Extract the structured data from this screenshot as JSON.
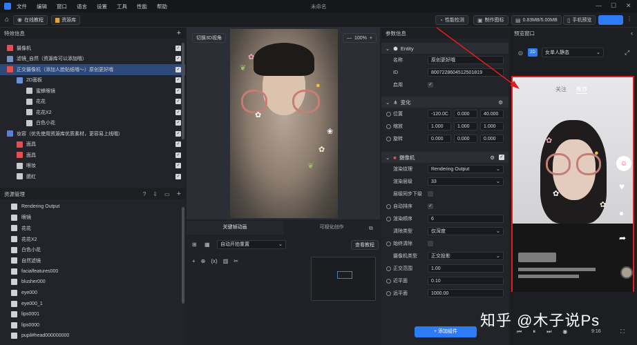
{
  "menubar": {
    "items": [
      "文件",
      "编辑",
      "窗口",
      "语言",
      "设置",
      "工具",
      "性能",
      "帮助"
    ],
    "title": "未命名"
  },
  "toolbar": {
    "online_tutorial": "在线教程",
    "asset_library": "资源库",
    "perf_check": "性能检测",
    "make_icon": "制作图标",
    "memory": "0.83MB/5.00MB",
    "phone_preview": "手机预览"
  },
  "effects_panel": {
    "title": "特效信息",
    "items": [
      {
        "label": "摄像机",
        "indent": 0
      },
      {
        "label": "滤镜_自然（资源库可以添加哦）",
        "indent": 0
      },
      {
        "label": "正交摄像机（添加人脸贴纸哦～）原创更好哦",
        "indent": 0,
        "selected": true
      },
      {
        "label": "2D面板",
        "indent": 1
      },
      {
        "label": "蜜蜂眼镜",
        "indent": 2
      },
      {
        "label": "花花",
        "indent": 2
      },
      {
        "label": "花花X2",
        "indent": 2
      },
      {
        "label": "白色小花",
        "indent": 2
      },
      {
        "label": "妆容（优先使用资源库优质素材，更容易上线哦）",
        "indent": 0
      },
      {
        "label": "面具",
        "indent": 1
      },
      {
        "label": "面具",
        "indent": 1
      },
      {
        "label": "眼妆",
        "indent": 1
      },
      {
        "label": "腮红",
        "indent": 1
      }
    ]
  },
  "resource_panel": {
    "title": "资源管理",
    "items": [
      "Rendering Output",
      "眼镜",
      "花花",
      "花花X2",
      "白色小花",
      "自然滤镜",
      "facialfeatures000",
      "blusher000",
      "eye000",
      "eye000_1",
      "lips0001",
      "lips0000",
      "pupil#head000000000"
    ]
  },
  "viewport": {
    "toggle_3d": "切换3D视角",
    "zoom": "100%"
  },
  "timeline": {
    "tab_keyframe": "关键帧动画",
    "tab_visual": "可视化创作",
    "play_mode": "自动开拍重置",
    "view_tutorial": "查看教程"
  },
  "params": {
    "title": "参数信息",
    "entity": {
      "title": "Entity",
      "name_label": "名称",
      "name_value": "原创更好哦",
      "id_label": "ID",
      "id_value": "8007228604512501819",
      "enable_label": "启用"
    },
    "transform": {
      "title": "变化",
      "pos_label": "位置",
      "pos": [
        "-120.0C",
        "0.000",
        "40.000"
      ],
      "scale_label": "缩放",
      "scale": [
        "1.000",
        "1.000",
        "1.000"
      ],
      "rot_label": "旋转",
      "rot": [
        "0.000",
        "0.000",
        "0.000"
      ]
    },
    "camera": {
      "title": "摄像机",
      "rt_label": "渲染纹理",
      "rt_value": "Rendering Output",
      "layer_label": "渲染层级",
      "layer_value": "33",
      "sync_label": "层级同步下级",
      "autosort_label": "自动排序",
      "order_label": "渲染顺序",
      "order_value": "6",
      "clear_label": "清除类型",
      "clear_value": "仅深度",
      "alwaysclear_label": "始终清除",
      "camtype_label": "摄像机类型",
      "camtype_value": "正交投影",
      "ortho_label": "正交范围",
      "ortho_value": "1.00",
      "near_label": "近平面",
      "near_value": "0.10",
      "far_label": "远平面",
      "far_value": "1000.00"
    },
    "add_component": "添加组件"
  },
  "preview": {
    "title": "预览窗口",
    "preset": "女单人静态",
    "tab_follow": "关注",
    "tab_recommend": "推荐",
    "time": "9:16"
  },
  "watermark": "知乎 @木子说Ps",
  "colors": {
    "accent": "#2e7bf6",
    "highlight": "#e11d1d"
  }
}
